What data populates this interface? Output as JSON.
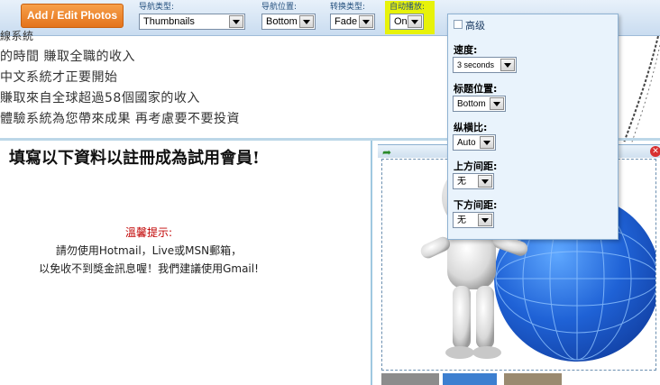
{
  "toolbar": {
    "add_button": "Add / Edit Photos",
    "nav_type": {
      "label": "导航类型:",
      "value": "Thumbnails"
    },
    "nav_position": {
      "label": "导航位置:",
      "value": "Bottom"
    },
    "transition": {
      "label": "转换类型:",
      "value": "Fade"
    },
    "autoplay": {
      "label": "自动播放:",
      "value": "On"
    },
    "highlight_color": "#e7f20a"
  },
  "marquee": [
    "線系統",
    "的時間 賺取全職的收入",
    "中文系統才正要開始",
    "賺取來自全球超過58個國家的收入",
    "體驗系統為您帶來成果 再考慮要不要投資"
  ],
  "registration": {
    "title": "填寫以下資料以註冊成為試用會員!",
    "notice_title": "溫馨提示:",
    "notice_line1": "請勿使用Hotmail，Live或MSN郵箱，",
    "notice_line2": "以免收不到獎金訊息喔！我們建議使用Gmail!"
  },
  "advanced": {
    "title": "高级",
    "speed": {
      "label": "速度:",
      "value": "3 seconds"
    },
    "title_position": {
      "label": "标题位置:",
      "value": "Bottom"
    },
    "aspect_ratio": {
      "label": "纵横比:",
      "value": "Auto"
    },
    "top_margin": {
      "label": "上方间距:",
      "value": "无"
    },
    "bottom_margin": {
      "label": "下方间距:",
      "value": "无"
    }
  },
  "icons": {
    "dropdown": "chevron-down-icon",
    "move": "arrow-icon",
    "close": "close-icon"
  },
  "colors": {
    "accent_orange": "#e4731b",
    "toolbar_bg": "#c9dcf0",
    "notice_red": "#c00000",
    "globe_blue": "#1f62d6"
  }
}
